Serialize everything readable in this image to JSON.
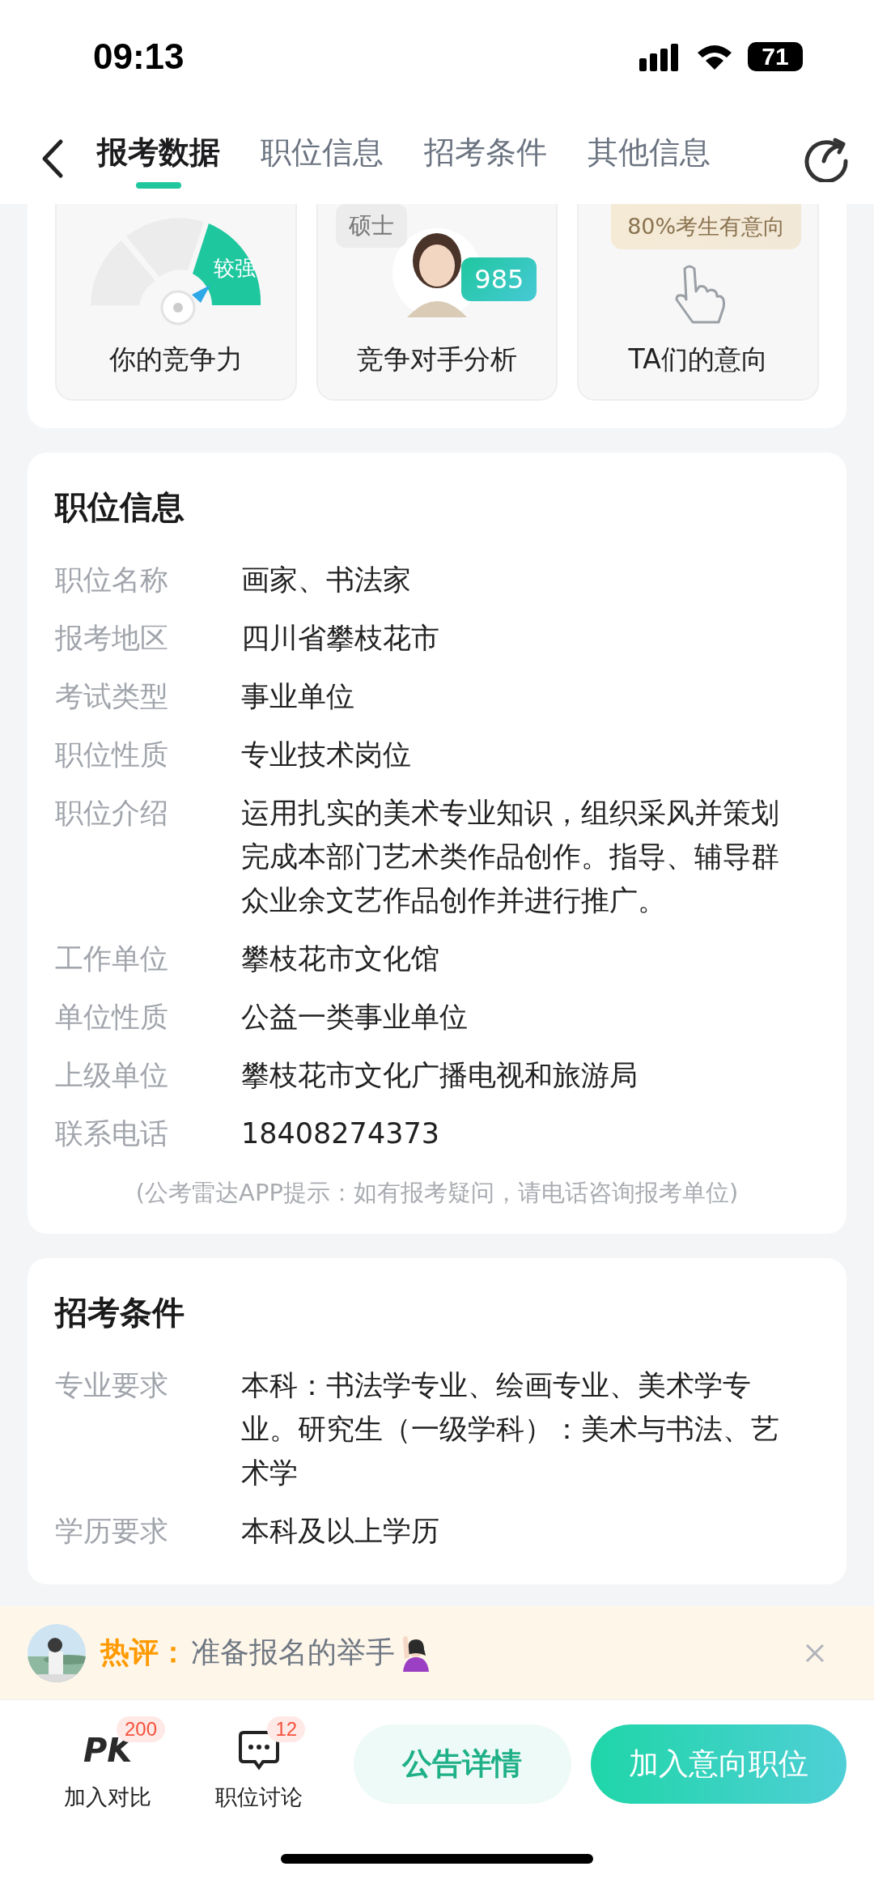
{
  "status_bar": {
    "time": "09:13",
    "battery": "71"
  },
  "nav": {
    "tabs": [
      {
        "label": "报考数据",
        "selected": true
      },
      {
        "label": "职位信息",
        "selected": false
      },
      {
        "label": "招考条件",
        "selected": false
      },
      {
        "label": "其他信息",
        "selected": false
      }
    ]
  },
  "overview": {
    "tiles": [
      {
        "kind": "gauge",
        "label": "你的竞争力",
        "tag": "较强"
      },
      {
        "kind": "rivals",
        "label": "竞争对手分析",
        "bubbles": [
          "硕士",
          "985"
        ]
      },
      {
        "kind": "intent",
        "label": "TA们的意向",
        "banner": "80%考生有意向"
      }
    ]
  },
  "sections": [
    {
      "title": "职位信息",
      "rows": [
        {
          "label": "职位名称",
          "value": "画家、书法家"
        },
        {
          "label": "报考地区",
          "value": "四川省攀枝花市"
        },
        {
          "label": "考试类型",
          "value": "事业单位"
        },
        {
          "label": "职位性质",
          "value": "专业技术岗位"
        },
        {
          "label": "职位介绍",
          "value": "运用扎实的美术专业知识，组织采风并策划完成本部门艺术类作品创作。指导、辅导群众业余文艺作品创作并进行推广。"
        },
        {
          "label": "工作单位",
          "value": "攀枝花市文化馆"
        },
        {
          "label": "单位性质",
          "value": "公益一类事业单位"
        },
        {
          "label": "上级单位",
          "value": "攀枝花市文化广播电视和旅游局"
        },
        {
          "label": "联系电话",
          "value": "18408274373"
        }
      ],
      "note": "(公考雷达APP提示：如有报考疑问，请电话咨询报考单位)"
    },
    {
      "title": "招考条件",
      "rows": [
        {
          "label": "专业要求",
          "value": "本科：书法学专业、绘画专业、美术学专业。研究生（一级学科）：美术与书法、艺术学"
        },
        {
          "label": "学历要求",
          "value": "本科及以上学历"
        }
      ]
    }
  ],
  "hot_comment": {
    "prefix": "热评：",
    "text": "准备报名的举手"
  },
  "bottom_bar": {
    "actions": [
      {
        "kind": "pk",
        "icon_text": "PK",
        "badge": "200",
        "label": "加入对比"
      },
      {
        "kind": "chat",
        "badge": "12",
        "label": "职位讨论"
      }
    ],
    "buttons": [
      {
        "kind": "secondary",
        "label": "公告详情"
      },
      {
        "kind": "primary",
        "label": "加入意向职位"
      }
    ]
  }
}
